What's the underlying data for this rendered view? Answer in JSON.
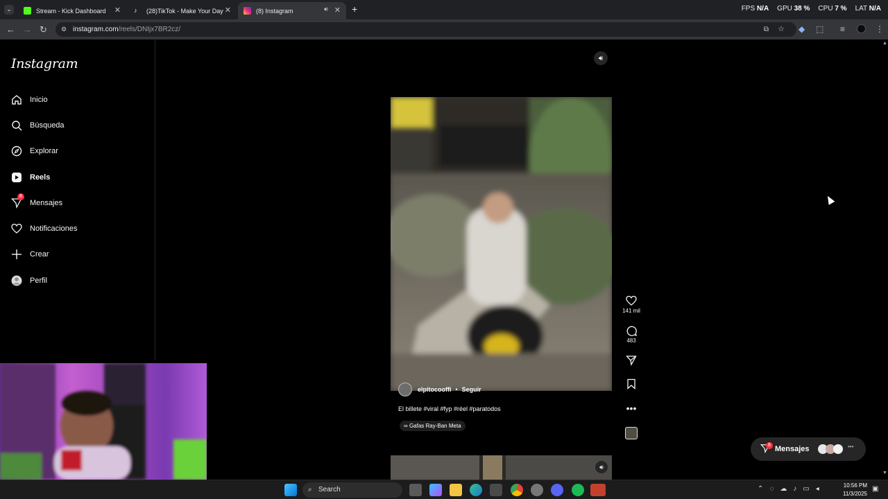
{
  "browser": {
    "tabs": [
      {
        "title": "Stream - Kick Dashboard",
        "favicon": "kick-icon",
        "color": "#53fc18"
      },
      {
        "title": "(28)TikTok - Make Your Day",
        "favicon": "tiktok-icon",
        "color": "#ffffff"
      },
      {
        "title": "(8) Instagram",
        "favicon": "instagram-icon",
        "color": "#e1306c",
        "active": true
      }
    ],
    "url_host": "instagram.com",
    "url_path": "/reels/DNIjx7BR2cz/",
    "overlay": {
      "fps_label": "FPS",
      "fps_value": "N/A",
      "gpu_label": "GPU",
      "gpu_value": "38 %",
      "cpu_label": "CPU",
      "cpu_value": "7 %",
      "lat_label": "LAT",
      "lat_value": "N/A"
    }
  },
  "sidebar": {
    "logo": "Instagram",
    "items": [
      {
        "label": "Inicio",
        "icon": "home-icon"
      },
      {
        "label": "Búsqueda",
        "icon": "search-icon"
      },
      {
        "label": "Explorar",
        "icon": "compass-icon"
      },
      {
        "label": "Reels",
        "icon": "reels-icon",
        "active": true
      },
      {
        "label": "Mensajes",
        "icon": "messenger-icon",
        "badge": "8"
      },
      {
        "label": "Notificaciones",
        "icon": "heart-icon"
      },
      {
        "label": "Crear",
        "icon": "plus-icon"
      },
      {
        "label": "Perfil",
        "icon": "avatar-icon"
      }
    ]
  },
  "reel": {
    "username": "elpitocooffi",
    "separator": "•",
    "follow": "Seguir",
    "caption": "El billete #viral #fyp #réel #paratodos",
    "music_tag": "Gafas Ray-Ban Meta",
    "likes": "141 mil",
    "comments": "483"
  },
  "messages_pill": {
    "label": "Mensajes",
    "badge": "8"
  },
  "taskbar": {
    "search_placeholder": "Search",
    "time": "10:56 PM",
    "date": "11/3/2025"
  }
}
